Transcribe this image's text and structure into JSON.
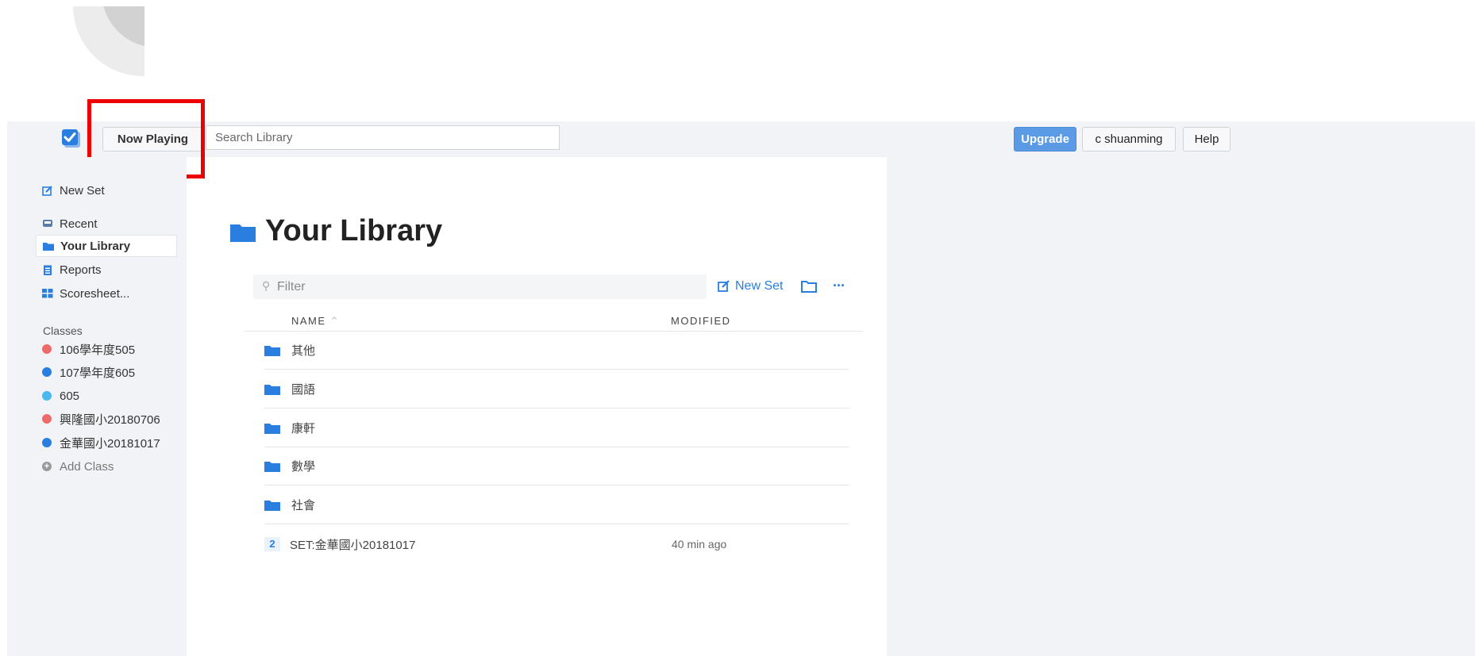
{
  "topbar": {
    "now_playing": "Now Playing",
    "search_placeholder": "Search Library",
    "upgrade": "Upgrade",
    "user": "c shuanming",
    "help": "Help"
  },
  "sidebar": {
    "new_set": "New Set",
    "nav": [
      {
        "label": "Recent",
        "icon": "recent-icon"
      },
      {
        "label": "Your Library",
        "icon": "folder-icon"
      },
      {
        "label": "Reports",
        "icon": "reports-icon"
      },
      {
        "label": "Scoresheet...",
        "icon": "grid-icon"
      }
    ],
    "classes_heading": "Classes",
    "classes": [
      {
        "label": "106學年度505",
        "color": "#ef6b6b"
      },
      {
        "label": "107學年度605",
        "color": "#2a7ee0"
      },
      {
        "label": "605",
        "color": "#49b8ef"
      },
      {
        "label": "興隆國小20180706",
        "color": "#ef6b6b"
      },
      {
        "label": "金華國小20181017",
        "color": "#2a7ee0"
      }
    ],
    "add_class": "Add Class"
  },
  "main": {
    "title": "Your Library",
    "filter_placeholder": "Filter",
    "new_set": "New Set",
    "more": "···",
    "col_name": "NAME",
    "col_modified": "MODIFIED",
    "rows": [
      {
        "name": "其他"
      },
      {
        "name": "國語"
      },
      {
        "name": "康軒"
      },
      {
        "name": "數學"
      },
      {
        "name": "社會"
      },
      {
        "count": "2",
        "name": "SET:金華國小20181017",
        "modified": "40 min ago"
      }
    ]
  },
  "colors": {
    "accent": "#2a7ee0",
    "upgrade": "#5b9be6",
    "annotation": "#ee0000"
  }
}
